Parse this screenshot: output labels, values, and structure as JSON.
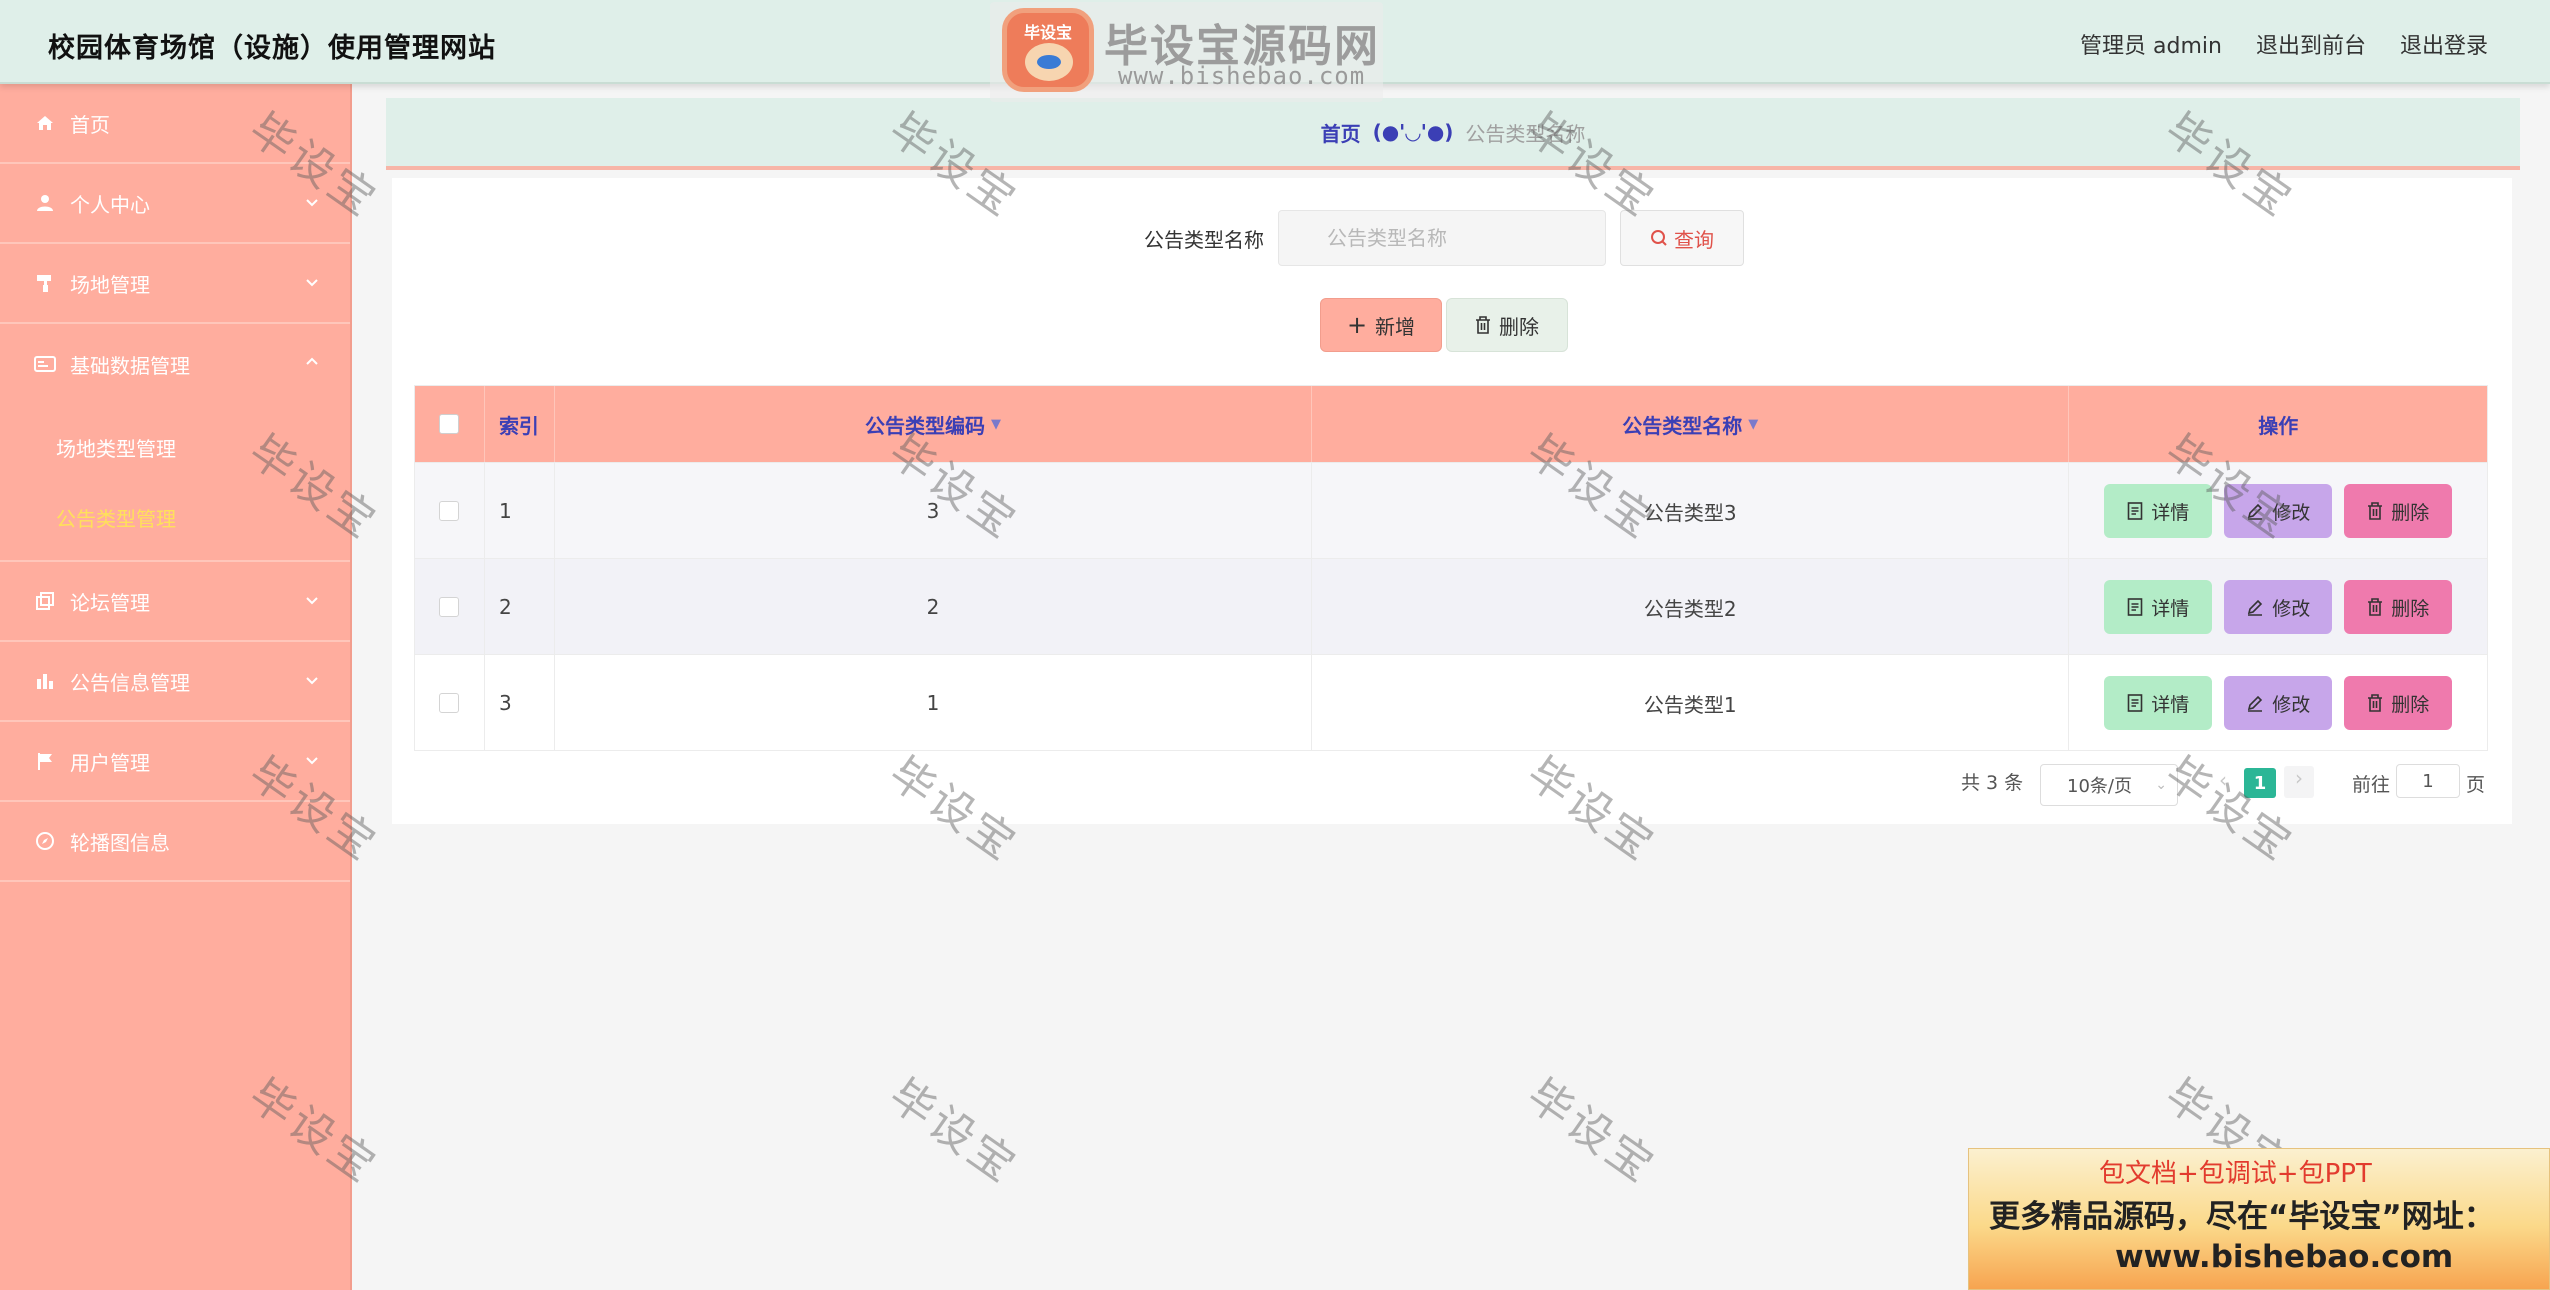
{
  "header": {
    "site_title": "校园体育场馆（设施）使用管理网站",
    "admin_label": "管理员 admin",
    "back_to_front": "退出到前台",
    "logout": "退出登录",
    "logo_badge": "毕设宝",
    "logo_title": "毕设宝源码网",
    "logo_url": "www.bishebao.com"
  },
  "sidebar": {
    "items": [
      {
        "label": "首页",
        "icon": "home-icon",
        "expandable": false
      },
      {
        "label": "个人中心",
        "icon": "user-icon",
        "expandable": true
      },
      {
        "label": "场地管理",
        "icon": "paint-roller-icon",
        "expandable": true
      },
      {
        "label": "基础数据管理",
        "icon": "id-card-icon",
        "expandable": true,
        "expanded": true,
        "children": [
          {
            "label": "场地类型管理",
            "active": false
          },
          {
            "label": "公告类型管理",
            "active": true
          }
        ]
      },
      {
        "label": "论坛管理",
        "icon": "copy-icon",
        "expandable": true
      },
      {
        "label": "公告信息管理",
        "icon": "bar-chart-icon",
        "expandable": true
      },
      {
        "label": "用户管理",
        "icon": "flag-icon",
        "expandable": true
      },
      {
        "label": "轮播图信息",
        "icon": "compass-icon",
        "expandable": false
      }
    ]
  },
  "breadcrumb": {
    "home": "首页",
    "separator": "(●'◡'●)",
    "current": "公告类型名称"
  },
  "search": {
    "label": "公告类型名称",
    "placeholder": "公告类型名称",
    "button": "查询"
  },
  "actions": {
    "add": "新增",
    "delete": "删除"
  },
  "table": {
    "headers": {
      "index": "索引",
      "code": "公告类型编码",
      "name": "公告类型名称",
      "ops": "操作"
    },
    "rows": [
      {
        "index": "1",
        "code": "3",
        "name": "公告类型3"
      },
      {
        "index": "2",
        "code": "2",
        "name": "公告类型2"
      },
      {
        "index": "3",
        "code": "1",
        "name": "公告类型1"
      }
    ],
    "op_labels": {
      "detail": "详情",
      "edit": "修改",
      "delete": "删除"
    }
  },
  "pagination": {
    "total": "共 3 条",
    "page_size": "10条/页",
    "current_page": "1",
    "goto_label": "前往",
    "goto_value": "1",
    "page_suffix": "页"
  },
  "watermark": "毕设宝",
  "ad": {
    "line1": "包文档+包调试+包PPT",
    "line2": "更多精品源码，尽在“毕设宝”网址：",
    "line3": "www.bishebao.com"
  },
  "colors": {
    "header_bg": "#dfefe9",
    "sidebar_bg": "#ffad9e",
    "active_submenu": "#ffe15a",
    "table_header_bg": "#ffad9e",
    "header_text": "#3b3fb5",
    "detail_btn": "#b3ecc7",
    "edit_btn": "#c7a6ea",
    "delete_btn": "#ef7aad",
    "page_active": "#2bb696"
  }
}
